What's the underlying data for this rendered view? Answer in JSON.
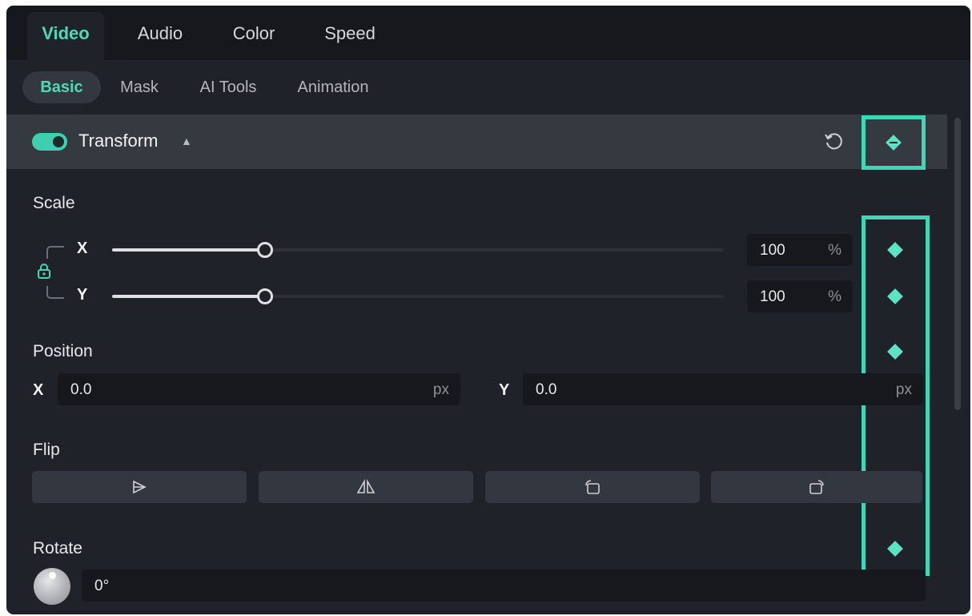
{
  "tabs": [
    "Video",
    "Audio",
    "Color",
    "Speed"
  ],
  "subtabs": [
    "Basic",
    "Mask",
    "AI Tools",
    "Animation"
  ],
  "transform": {
    "title": "Transform",
    "enabled": true
  },
  "scale": {
    "label": "Scale",
    "x_label": "X",
    "y_label": "Y",
    "x_value": "100",
    "y_value": "100",
    "unit": "%",
    "x_level": 0.25,
    "y_level": 0.25
  },
  "position": {
    "label": "Position",
    "x_label": "X",
    "y_label": "Y",
    "x_value": "0.0",
    "y_value": "0.0",
    "unit": "px"
  },
  "flip": {
    "label": "Flip",
    "buttons": [
      "flip-horizontal-icon",
      "flip-vertical-icon",
      "rotate-left-icon",
      "rotate-right-icon"
    ]
  },
  "rotate": {
    "label": "Rotate",
    "value": "0°"
  },
  "colors": {
    "accent": "#3fd6b5",
    "panel_bg": "#202229",
    "header_bg": "#353a40"
  }
}
